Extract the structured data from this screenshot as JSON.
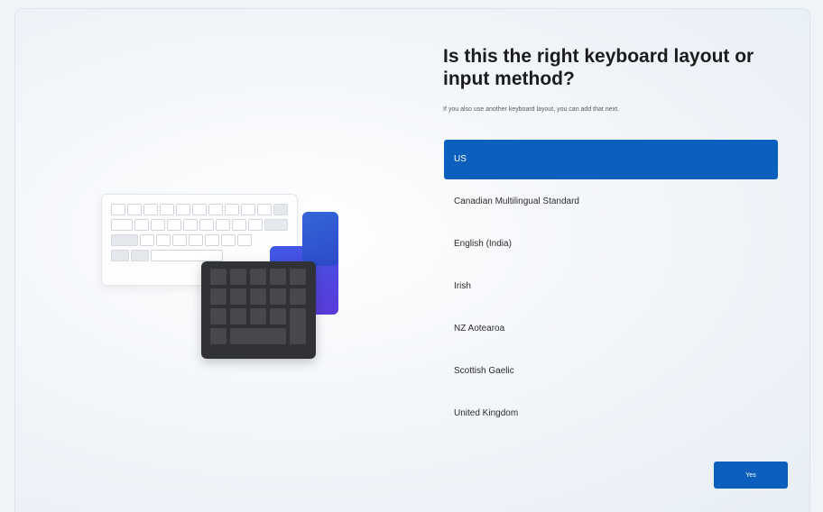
{
  "page": {
    "title": "Is this the right keyboard layout or input method?",
    "subtitle": "If you also use another keyboard layout, you can add that next."
  },
  "layouts": [
    {
      "label": "US",
      "selected": true
    },
    {
      "label": "Canadian Multilingual Standard",
      "selected": false
    },
    {
      "label": "English (India)",
      "selected": false
    },
    {
      "label": "Irish",
      "selected": false
    },
    {
      "label": "NZ Aotearoa",
      "selected": false
    },
    {
      "label": "Scottish Gaelic",
      "selected": false
    },
    {
      "label": "United Kingdom",
      "selected": false
    }
  ],
  "actions": {
    "yes_label": "Yes"
  },
  "theme": {
    "accent": "#0c5fbd",
    "card_blue": "#3566d9",
    "card_purple": "#5b3ad8",
    "keypad": "#303236"
  }
}
